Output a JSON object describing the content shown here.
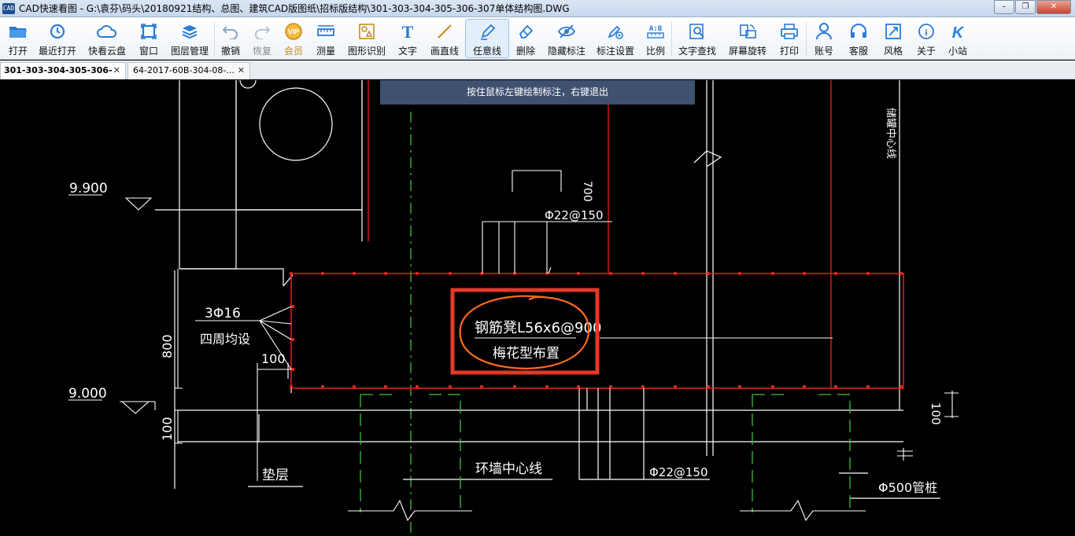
{
  "window": {
    "icon_text": "CAD",
    "title": "CAD快速看图 - G:\\袁芬\\码头\\20180921结构、总图、建筑CAD版图纸\\招标版结构\\301-303-304-305-306-307单体结构图.DWG",
    "controls": {
      "minimize": "–",
      "maximize": "❐",
      "close": "✕"
    }
  },
  "toolbar": {
    "items": [
      {
        "label": "打开",
        "icon": "open-folder-icon"
      },
      {
        "label": "最近打开",
        "icon": "recent-clock-icon"
      },
      {
        "label": "快看云盘",
        "icon": "cloud-icon"
      },
      {
        "label": "窗口",
        "icon": "window-icon"
      },
      {
        "label": "图层管理",
        "icon": "layers-icon"
      },
      {
        "label": "撤销",
        "icon": "undo-icon"
      },
      {
        "label": "恢复",
        "icon": "redo-icon"
      },
      {
        "label": "会员",
        "icon": "vip-icon",
        "icon_text": "VIP"
      },
      {
        "label": "测量",
        "icon": "ruler-icon"
      },
      {
        "label": "图形识别",
        "icon": "shape-recognize-icon"
      },
      {
        "label": "文字",
        "icon": "text-icon",
        "icon_text": "T"
      },
      {
        "label": "画直线",
        "icon": "line-icon"
      },
      {
        "label": "任意线",
        "icon": "pen-icon"
      },
      {
        "label": "删除",
        "icon": "eraser-icon"
      },
      {
        "label": "隐藏标注",
        "icon": "eye-hide-icon"
      },
      {
        "label": "标注设置",
        "icon": "annotation-settings-icon"
      },
      {
        "label": "比例",
        "icon": "scale-icon",
        "icon_text": "A:B"
      },
      {
        "label": "文字查找",
        "icon": "text-search-icon"
      },
      {
        "label": "屏幕旋转",
        "icon": "rotate-screen-icon"
      },
      {
        "label": "打印",
        "icon": "printer-icon"
      },
      {
        "label": "账号",
        "icon": "account-icon"
      },
      {
        "label": "客服",
        "icon": "headset-icon"
      },
      {
        "label": "风格",
        "icon": "style-icon"
      },
      {
        "label": "关于",
        "icon": "info-icon",
        "icon_text": "i"
      },
      {
        "label": "小站",
        "icon": "k-logo-icon",
        "icon_text": "K"
      }
    ]
  },
  "tabs": [
    {
      "label": "301-303-304-305-306-",
      "close": "✕",
      "active": true
    },
    {
      "label": "64-2017-60B-304-08-...",
      "close": "✕",
      "active": false
    }
  ],
  "canvas": {
    "hint": "按住鼠标左键绘制标注，右键退出",
    "texts": {
      "elev_top": "9.900",
      "elev_bottom": "9.000",
      "rebar_top": "Φ22@150",
      "rebar_bottom": "Φ22@150",
      "dim_700": "700",
      "bars_count": "3Φ16",
      "bars_note": "四周均设",
      "dim_100_left": "100",
      "dim_800": "800",
      "dim_100_bottom": "100",
      "dim_100_right": "100",
      "annot_line1": "钢筋凳L56x6@900",
      "annot_line2": "梅花型布置",
      "layer_label": "垫层",
      "wall_center": "环墙中心线",
      "pile_label": "Φ500管桩",
      "axis_label": "储罐中心线"
    }
  },
  "colors": {
    "canvas_bg": "#000000",
    "cad_line": "#ffffff",
    "rebar_red": "#ff2020",
    "dash_green": "#3fbf3f",
    "markup_red": "#e03a2a",
    "markup_orange": "#ff6a1a",
    "hint_bg": "#3f5170"
  }
}
